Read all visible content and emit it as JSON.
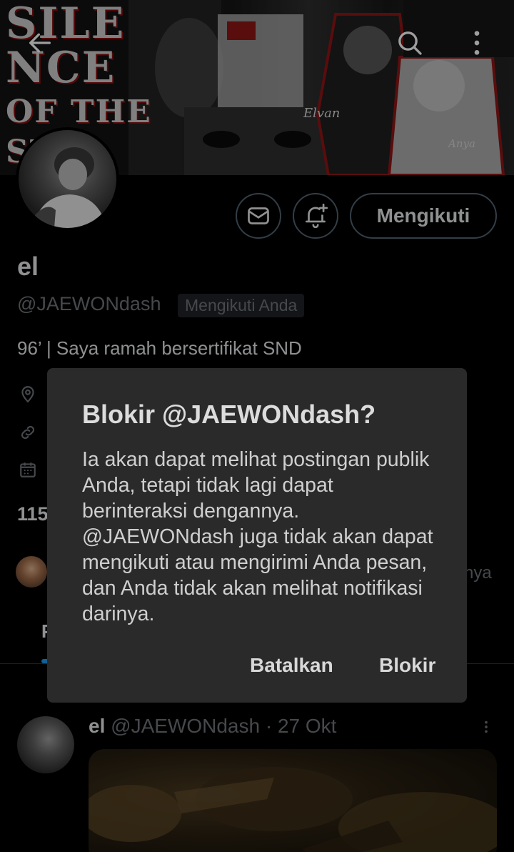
{
  "header": {
    "back_icon": "arrow-left-icon",
    "search_icon": "search-icon",
    "more_icon": "more-vertical-icon",
    "banner_words": [
      "SILE",
      "NCE",
      "OF THE",
      "ST"
    ],
    "banner_names": [
      "Elvan",
      "Anya"
    ]
  },
  "profile": {
    "display_name": "el",
    "handle": "@JAEWONdash",
    "follows_you_badge": "Mengikuti Anda",
    "bio": "96’ | Saya ramah bersertifikat SND",
    "message_icon": "mail-icon",
    "notify_icon": "bell-plus-icon",
    "follow_button": "Mengikuti",
    "meta_icons": [
      "location-icon",
      "link-icon",
      "calendar-icon"
    ],
    "count_fragment": "115",
    "followers_fragment": "nya",
    "tab_fragment": "P"
  },
  "tweet": {
    "name": "el",
    "handle": "@JAEWONdash",
    "separator": " · ",
    "date": "27 Okt",
    "more_icon": "more-vertical-icon"
  },
  "dialog": {
    "title": "Blokir @JAEWONdash?",
    "body": "Ia akan dapat melihat postingan publik Anda, tetapi tidak lagi dapat berinteraksi dengannya. @JAEWONdash juga tidak akan dapat mengikuti atau mengirimi Anda pesan, dan Anda tidak akan melihat notifikasi darinya.",
    "cancel": "Batalkan",
    "confirm": "Blokir"
  },
  "colors": {
    "background": "#000000",
    "dialog_bg": "#2a2a2b",
    "secondary_text": "#71767b",
    "accent_blue": "#1d9bf0",
    "border": "#536471"
  }
}
